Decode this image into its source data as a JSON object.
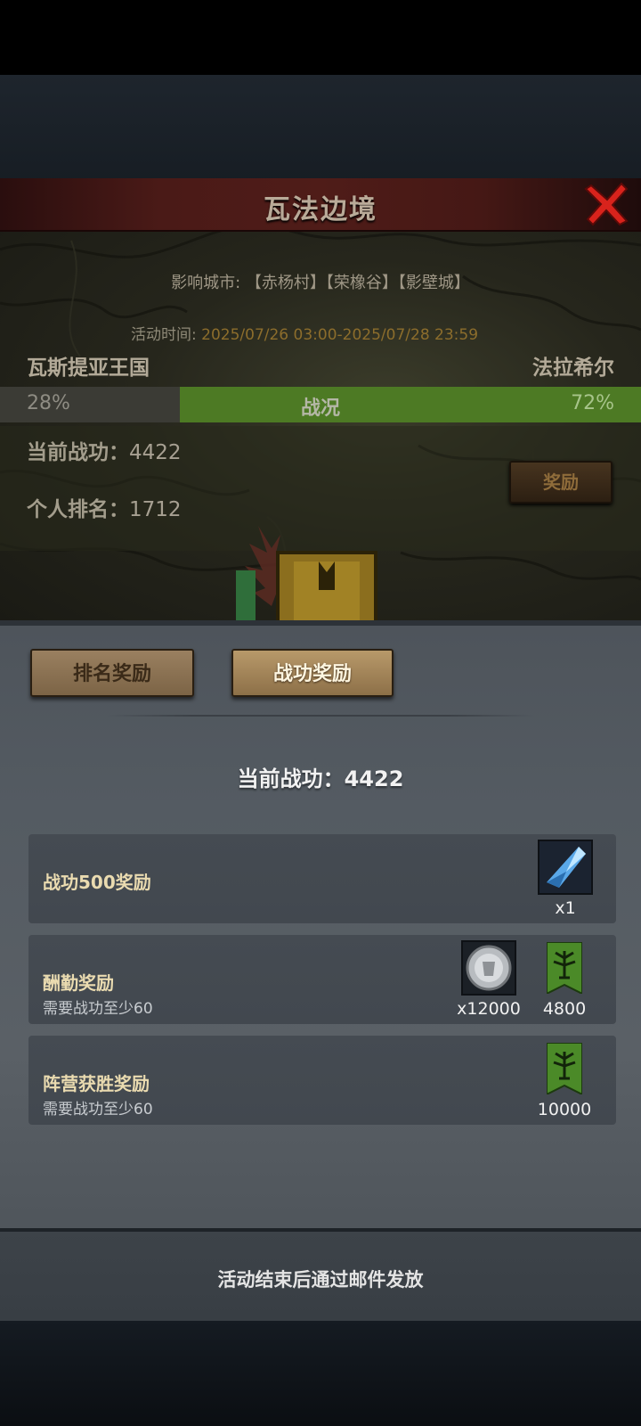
{
  "event": {
    "title": "瓦法边境",
    "cities_label": "影响城市:",
    "cities_value": "【赤杨村】【荣橡谷】【影壁城】",
    "time_label": "活动时间:",
    "time_value": "2025/07/26 03:00-2025/07/28 23:59",
    "faction_left": "瓦斯提亚王国",
    "faction_right": "法拉希尔",
    "war_label": "战况",
    "pct_left": "28%",
    "pct_right": "72%",
    "pct_left_value": 28,
    "pct_right_value": 72,
    "merit_label": "当前战功：",
    "merit_value": "4422",
    "rank_label": "个人排名：",
    "rank_value": "1712",
    "reward_button": "奖励"
  },
  "rewards": {
    "tabs": [
      {
        "label": "排名奖励",
        "active": false
      },
      {
        "label": "战功奖励",
        "active": true
      }
    ],
    "current_merit": "当前战功：4422",
    "rows": [
      {
        "title": "战功500奖励",
        "subtitle": "",
        "items": [
          {
            "icon": "blue-crystal-icon",
            "count": "x1"
          }
        ]
      },
      {
        "title": "酬勤奖励",
        "subtitle": "需要战功至少60",
        "items": [
          {
            "icon": "silver-coin-icon",
            "count": "x12000"
          },
          {
            "icon": "green-tree-banner-icon",
            "count": "4800"
          }
        ]
      },
      {
        "title": "阵营获胜奖励",
        "subtitle": "需要战功至少60",
        "items": [
          {
            "icon": "green-tree-banner-icon",
            "count": "10000"
          }
        ]
      }
    ],
    "footer_note": "活动结束后通过邮件发放"
  },
  "colors": {
    "title_band": "#4f1c18",
    "war_green": "#4d7a24",
    "close_red": "#d8231c",
    "panel_gray": "#545b62"
  }
}
